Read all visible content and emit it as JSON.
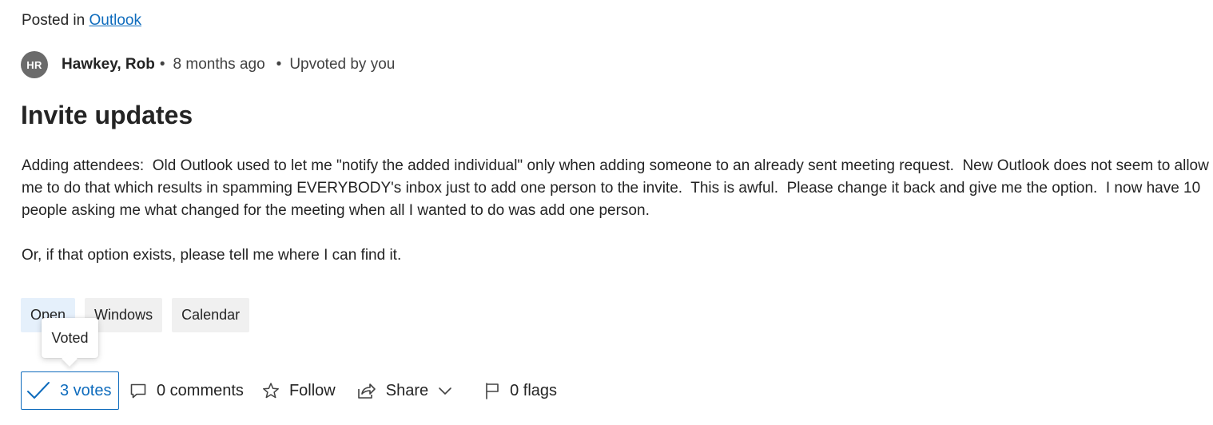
{
  "post": {
    "posted_in_prefix": "Posted in",
    "category": "Outlook",
    "author_initials": "HR",
    "author": "Hawkey, Rob",
    "time": "8 months ago",
    "upvoted": "Upvoted by you",
    "title": "Invite updates",
    "body_paragraph_1": "Adding attendees:  Old Outlook used to let me \"notify the added individual\" only when adding someone to an already sent meeting request.  New Outlook does not seem to allow me to do that which results in spamming EVERYBODY's inbox just to add one person to the invite.  This is awful.  Please change it back and give me the option.  I now have 10 people asking me what changed for the meeting when all I wanted to do was add one person.",
    "body_paragraph_2": "Or, if that option exists, please tell me where I can find it."
  },
  "tags": {
    "status": "Open",
    "items": [
      "Windows",
      "Calendar"
    ]
  },
  "tooltip": {
    "text": "Voted"
  },
  "actions": {
    "votes": "3 votes",
    "comments": "0 comments",
    "follow": "Follow",
    "share": "Share",
    "flags": "0 flags"
  },
  "colors": {
    "accent": "#0f6cbd",
    "avatar_bg": "#6b6b6b",
    "status_tag_bg": "#e5f0fb",
    "tag_bg": "#f0f0f0"
  },
  "icons": {
    "vote": "checkmark-icon",
    "comments": "comment-icon",
    "follow": "star-icon",
    "share": "share-icon",
    "share_menu": "chevron-down-icon",
    "flags": "flag-icon"
  }
}
